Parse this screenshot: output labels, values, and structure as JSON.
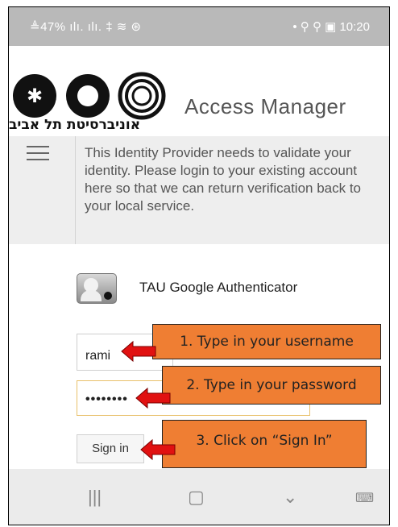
{
  "status": {
    "left": "≜47% ılı. ılı. ‡ ≋ ⊛",
    "right": "• ⚲ ⚲ ▣ 10:20"
  },
  "header": {
    "university_hebrew": "אוניברסיטת תל אביב",
    "title": "Access Manager"
  },
  "infobar": {
    "menu_icon": "hamburger-menu-icon",
    "message": "This Identity Provider needs to validate your identity. Please login to your existing account here so that we can return verification back to your local service."
  },
  "auth": {
    "icon": "user-avatar-icon",
    "label": "TAU Google Authenticator"
  },
  "form": {
    "username_value": "rami",
    "password_value": "••••••••",
    "signin_label": "Sign in"
  },
  "callouts": {
    "step1": "1. Type in your username",
    "step2": "2. Type in your password",
    "step3": "3. Click on “Sign In”"
  },
  "navbar": {
    "recents_icon": "recents-icon",
    "home_icon": "home-icon",
    "back_icon": "back-chevron-icon",
    "keyboard_icon": "keyboard-icon"
  },
  "colors": {
    "callout": "#ef7e33",
    "arrow": "#e11111",
    "statusbar": "#b9b9b9"
  }
}
